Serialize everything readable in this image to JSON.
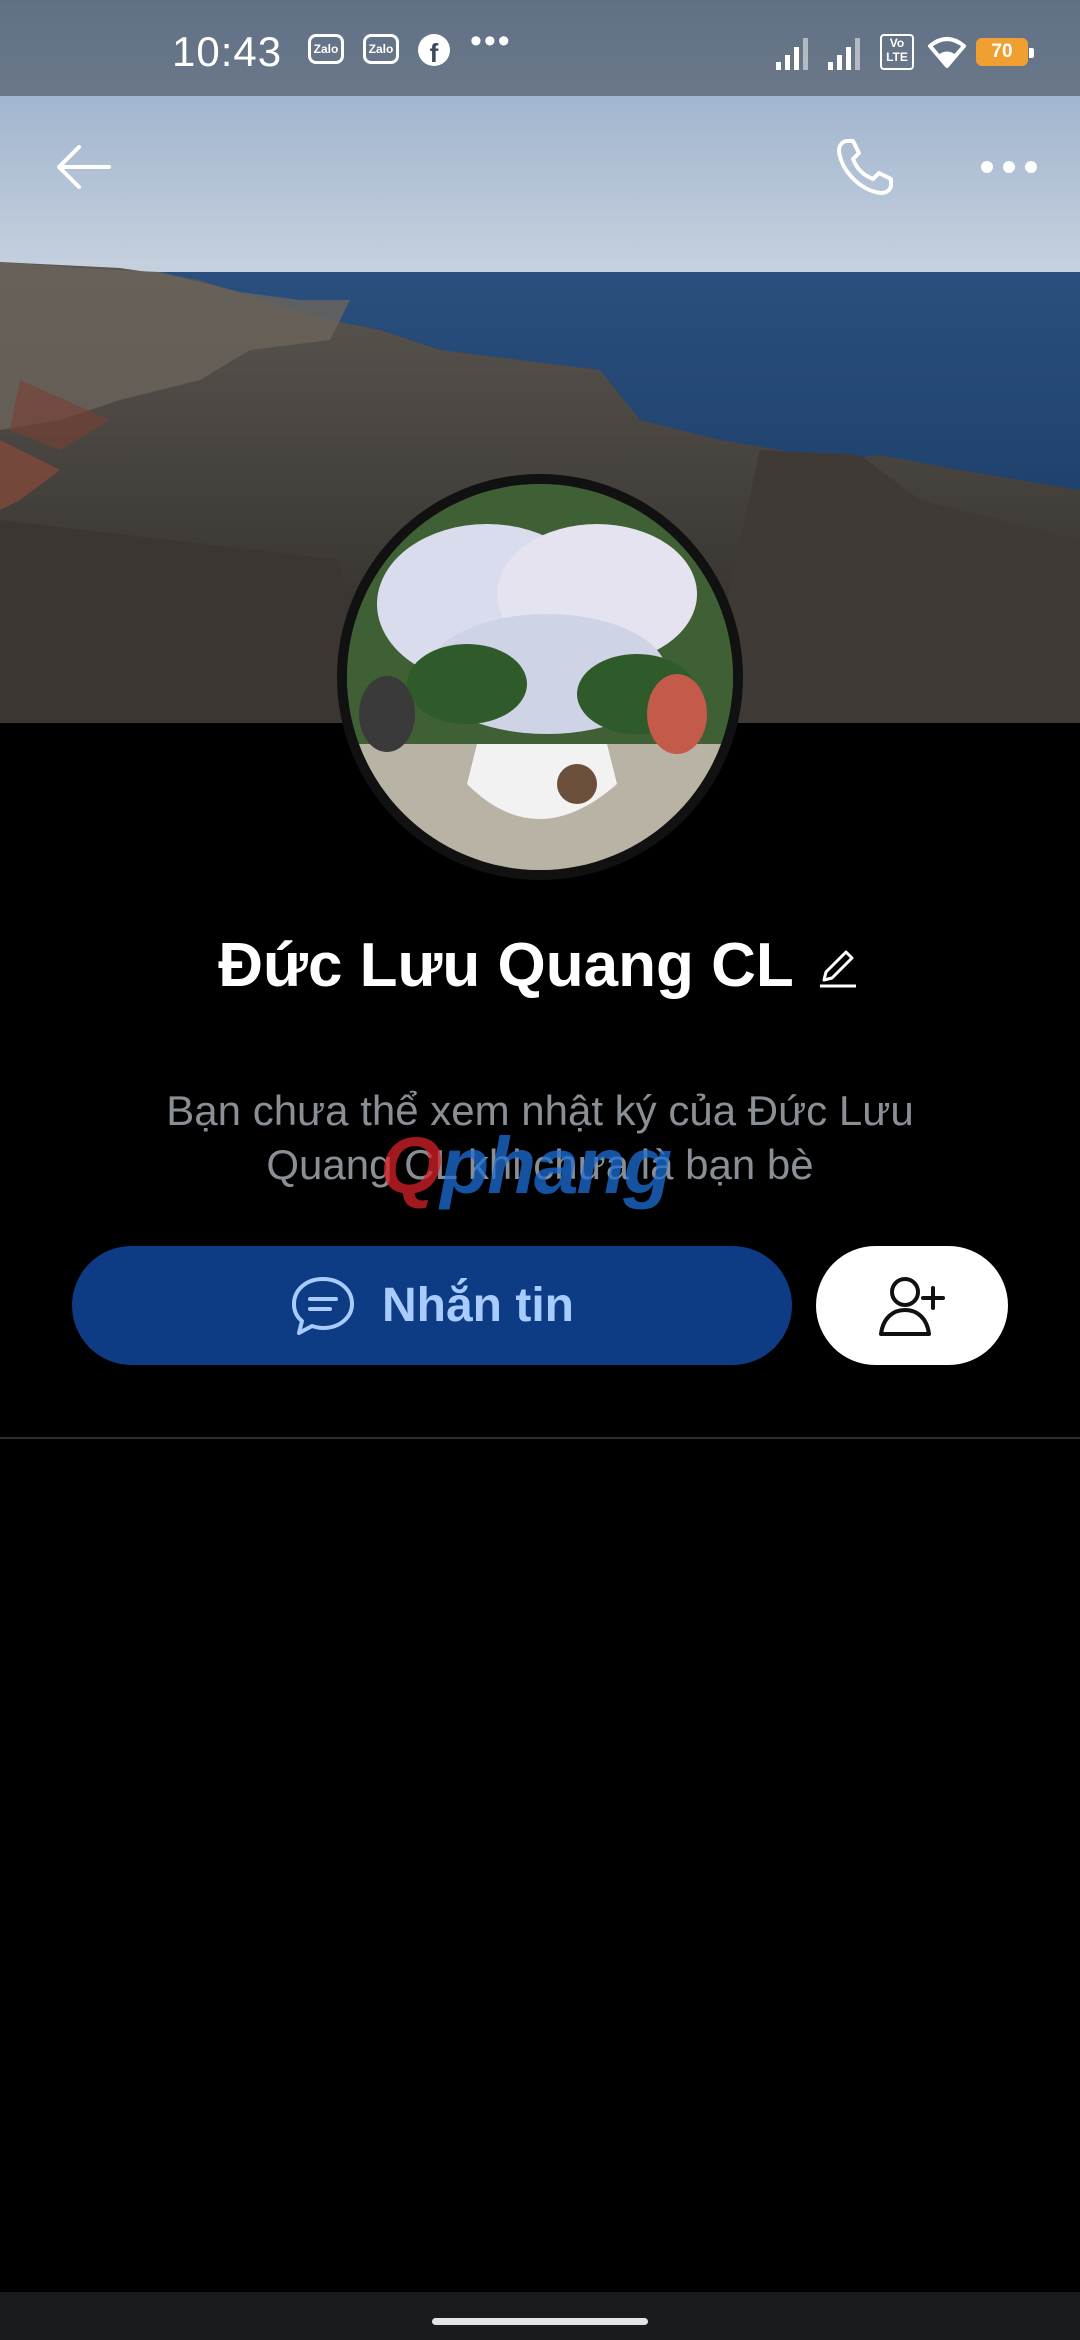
{
  "status_bar": {
    "time": "10:43",
    "notification_icons": [
      "zalo-icon",
      "zalo-icon",
      "facebook-icon",
      "more-dots-icon"
    ],
    "zalo_label": "Zalo",
    "facebook_label": "f",
    "more": "•••",
    "network_label": "Vo LTE",
    "battery_level": "70"
  },
  "header": {
    "back_icon": "arrow-left-icon",
    "call_icon": "phone-icon",
    "more_icon": "more-horizontal-icon"
  },
  "profile": {
    "name": "Đức Lưu Quang CL",
    "edit_icon": "pencil-icon",
    "notice": "Bạn chưa thể xem nhật ký của Đức Lưu Quang CL khi chưa là bạn bè"
  },
  "watermark": {
    "part1": "Q",
    "part2": "phang"
  },
  "actions": {
    "message_label": "Nhắn tin",
    "message_icon": "chat-bubble-icon",
    "add_friend_icon": "add-user-icon"
  },
  "colors": {
    "message_button_bg": "#0d3b84",
    "message_button_text": "#a8ccff",
    "background": "#000000",
    "battery": "#f0a030"
  }
}
